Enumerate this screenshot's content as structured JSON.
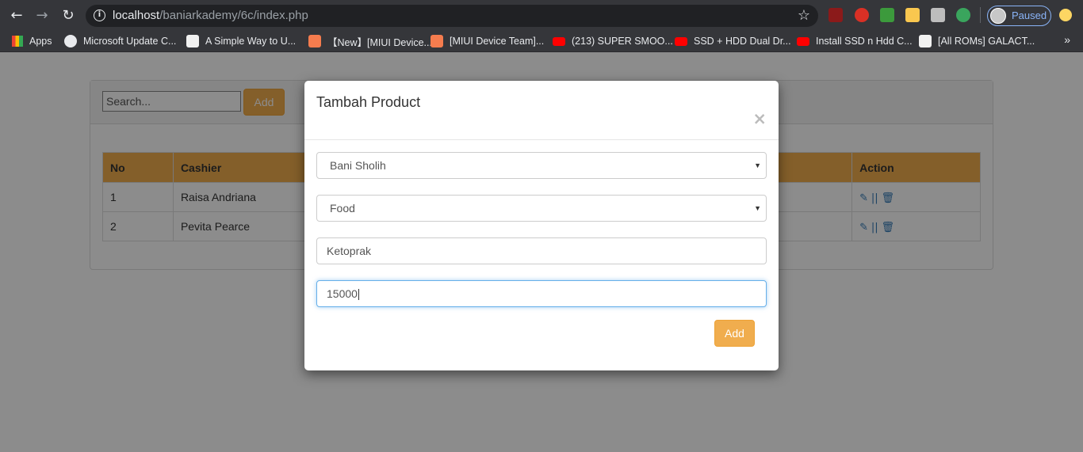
{
  "browser": {
    "url_host": "localhost",
    "url_path": "/baniarkademy/6c/index.php",
    "profile_label": "Paused",
    "bookmarks": [
      {
        "label": "Apps"
      },
      {
        "label": "Microsoft Update C..."
      },
      {
        "label": "A Simple Way to U..."
      },
      {
        "label": "【New】[MIUI Device..."
      },
      {
        "label": "[MIUI Device Team]..."
      },
      {
        "label": "(213) SUPER SMOO..."
      },
      {
        "label": "SSD + HDD Dual Dr..."
      },
      {
        "label": "Install SSD n Hdd C..."
      },
      {
        "label": "[All ROMs] GALACT..."
      }
    ],
    "more_label": "»"
  },
  "page": {
    "search_placeholder": "Search...",
    "add_button": "Add",
    "table": {
      "headers": [
        "No",
        "Cashier",
        "Action"
      ],
      "rows": [
        {
          "no": "1",
          "cashier": "Raisa Andriana"
        },
        {
          "no": "2",
          "cashier": "Pevita Pearce"
        }
      ],
      "action_separator": "||"
    }
  },
  "modal": {
    "title": "Tambah Product",
    "close": "×",
    "cashier_select": "Bani Sholih",
    "category_select": "Food",
    "name_input": "Ketoprak",
    "price_input": "15000",
    "submit": "Add"
  }
}
